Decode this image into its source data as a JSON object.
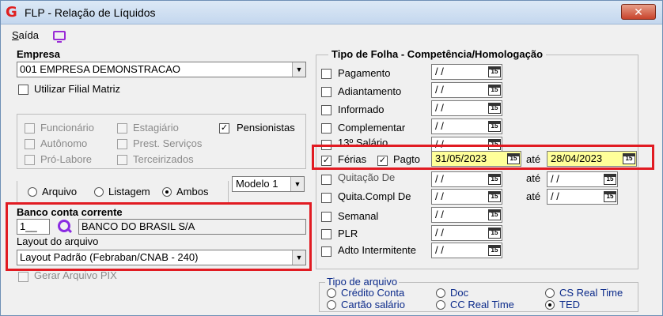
{
  "window": {
    "title": "FLP - Relação de Líquidos",
    "close_glyph": "✕",
    "app_icon_glyph": "G"
  },
  "menu": {
    "saida": "Saída",
    "saida_mnemonic": "S",
    "saida_rest": "aída"
  },
  "empresa": {
    "label": "Empresa",
    "value": "001 EMPRESA DEMONSTRACAO",
    "utilizar_filial": "Utilizar Filial Matriz"
  },
  "categorias": {
    "funcionario": "Funcionário",
    "estagiario": "Estagiário",
    "pensionistas": "Pensionistas",
    "autonomo": "Autônomo",
    "prest_servicos": "Prest. Serviços",
    "pro_labore": "Pró-Labore",
    "terceirizados": "Terceirizados"
  },
  "modelo": {
    "value": "Modelo 1"
  },
  "saida_tipo": {
    "arquivo": "Arquivo",
    "listagem": "Listagem",
    "ambos": "Ambos",
    "selected": "Ambos"
  },
  "banco": {
    "label": "Banco conta corrente",
    "code": "1__",
    "name": "BANCO DO BRASIL S/A",
    "layout_label": "Layout do arquivo",
    "layout_value": "Layout Padrão (Febraban/CNAB - 240)",
    "gerar_pix": "Gerar Arquivo PIX"
  },
  "tipo_folha": {
    "header": "Tipo de Folha  -  Competência/Homologação",
    "ate": "até",
    "pagto": "Pagto",
    "empty_date": "/ /",
    "items": [
      {
        "label": "Pagamento",
        "checked": false
      },
      {
        "label": "Adiantamento",
        "checked": false
      },
      {
        "label": "Informado",
        "checked": false
      },
      {
        "label": "Complementar",
        "checked": false
      },
      {
        "label": "13º Salário",
        "checked": false
      },
      {
        "label": "Férias",
        "checked": true
      },
      {
        "label": "Quitação De",
        "checked": false
      },
      {
        "label": "Quita.Compl De",
        "checked": false
      },
      {
        "label": "Semanal",
        "checked": false
      },
      {
        "label": "PLR",
        "checked": false
      },
      {
        "label": "Adto Intermitente",
        "checked": false
      }
    ],
    "ferias_start": "31/05/2023",
    "ferias_end": "28/04/2023"
  },
  "tipo_arquivo": {
    "label": "Tipo de arquivo",
    "credito_conta": "Crédito Conta",
    "doc": "Doc",
    "cs_real_time": "CS Real Time",
    "cartao_salario": "Cartão salário",
    "cc_real_time": "CC Real Time",
    "ted": "TED",
    "selected": "TED"
  },
  "colors": {
    "highlight_border": "#e11b22",
    "date_highlight": "#ffff99",
    "accent_icon": "#8a2be2"
  }
}
